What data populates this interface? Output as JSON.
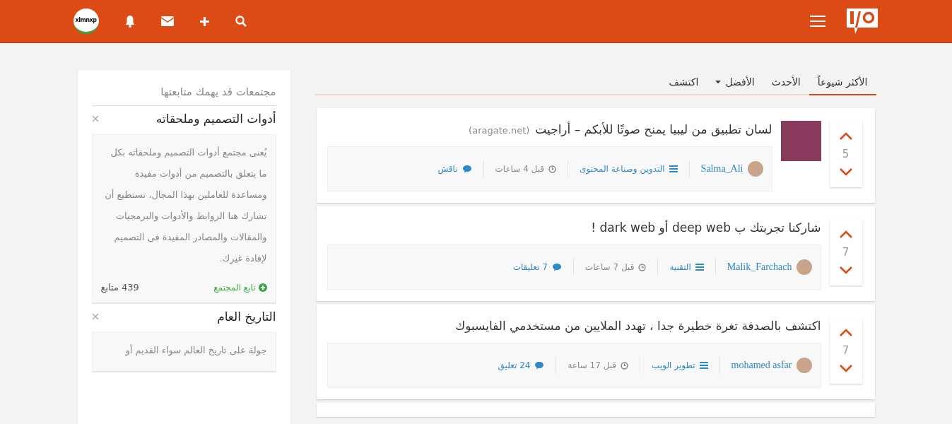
{
  "header": {
    "avatar_text": "xlmnxp"
  },
  "tabs": [
    {
      "label": "الأكثر شيوعاً",
      "selected": true,
      "has_menu": false
    },
    {
      "label": "الأحدث",
      "selected": false,
      "has_menu": false
    },
    {
      "label": "الأفضل",
      "selected": false,
      "has_menu": true
    },
    {
      "label": "اكتشف",
      "selected": false,
      "has_menu": false
    }
  ],
  "posts": [
    {
      "title": "لسان تطبيق من ليبيا يمنح صوتًا للأبكم – أراجيت",
      "domain": "(aragate.net)",
      "votes": "5",
      "has_thumbnail": true,
      "author": "Salma_Ali",
      "category": "التدوين وصناعة المحتوى",
      "time": "قبل 4 ساعات",
      "comments": "ناقش"
    },
    {
      "title": "شاركنا تجربتك ب deep web أو dark web !",
      "votes": "7",
      "has_thumbnail": false,
      "author": "Malik_Farchach",
      "category": "التقنية",
      "time": "قبل 7 ساعات",
      "comments": "7 تعليقات"
    },
    {
      "title": "اكتشف بالصدفة تغرة خطيرة جدا ، تهدد الملايين من مستخدمي الفايسبوك",
      "votes": "7",
      "has_thumbnail": false,
      "author": "mohamed asfar",
      "category": "تطوير الويب",
      "time": "قبل 17 ساعة",
      "comments": "24 تعليق"
    }
  ],
  "sidebar": {
    "heading": "مجتمعات قد يهمك متابعتها",
    "communities": [
      {
        "name": "أدوات التصميم وملحقاته",
        "description": "يُعنى مجتمع أدوات التصميم وملحقاته بكل ما يتعلق بالتصميم من أدوات مفيدة ومساعدة للعاملين بهذا المجال، تستطيع أن تشارك هنا الروابط والأدوات والبرمجيات والمقالات والمصادر المفيدة في التصميم لإفادة غيرك.",
        "follow": "تابع المجتمع",
        "followers": "439 متابع"
      },
      {
        "name": "التاريخ العام",
        "description": "جولة على تاريخ العالم سواء القديم أو"
      }
    ]
  }
}
